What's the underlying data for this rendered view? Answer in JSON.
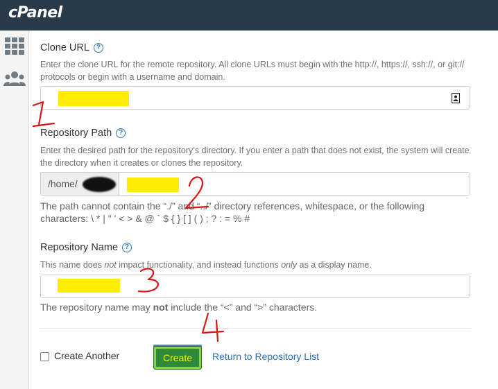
{
  "header": {
    "brand": "cPanel"
  },
  "sidebar": {
    "icons": [
      "grid-apps-icon",
      "users-icon"
    ]
  },
  "clone_url": {
    "label": "Clone URL",
    "help": "?",
    "description": "Enter the clone URL for the remote repository. All clone URLs must begin with the http://, https://, ssh://, or git:// protocols or begin with a username and domain.",
    "value": "",
    "field_icon": "contact-card-icon"
  },
  "repository_path": {
    "label": "Repository Path",
    "help": "?",
    "description": "Enter the desired path for the repository’s directory. If you enter a path that does not exist, the system will create the directory when it creates or clones the repository.",
    "prefix": "/home/",
    "value": "",
    "note": "The path cannot contain the “./” and “../” directory references, whitespace, or the following characters: \\ * | \" ' < > & @ ` $ { } [ ] ( ) ; ? : = % #"
  },
  "repository_name": {
    "label": "Repository Name",
    "help": "?",
    "desc_pre": "This name does ",
    "desc_em1": "not",
    "desc_mid": " impact functionality, and instead functions ",
    "desc_em2": "only",
    "desc_post": " as a display name.",
    "value": "",
    "note_pre": "The repository name may ",
    "note_bold": "not",
    "note_post": " include the “<” and “>” characters."
  },
  "actions": {
    "create_another": "Create Another",
    "create_another_checked": false,
    "create_button": "Create",
    "return_link": "Return to Repository List"
  },
  "colors": {
    "header_bg": "#293a4a",
    "highlight": "#ffec00",
    "annotation": "#d91616",
    "link": "#2a6fb0"
  }
}
